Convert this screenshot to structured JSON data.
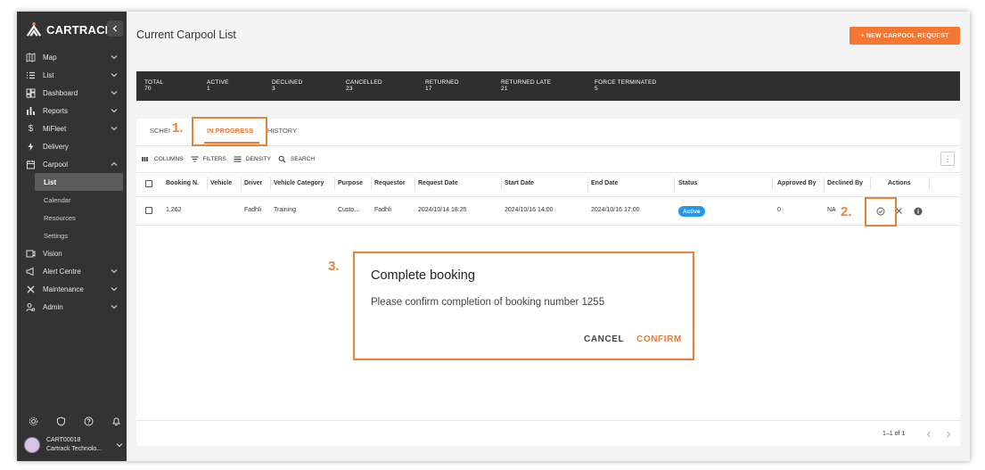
{
  "brand": {
    "name": "CARTRACK",
    "accent": "#f47735",
    "annotation_color": "#e9823a"
  },
  "sidebar": {
    "collapse_icon": "chevron-left-icon",
    "items": [
      {
        "label": "Map",
        "icon": "map-icon",
        "expandable": true
      },
      {
        "label": "List",
        "icon": "list-icon",
        "expandable": true
      },
      {
        "label": "Dashboard",
        "icon": "dashboard-icon",
        "expandable": true
      },
      {
        "label": "Reports",
        "icon": "bar-chart-icon",
        "expandable": true
      },
      {
        "label": "MiFleet",
        "icon": "dollar-icon",
        "expandable": true
      },
      {
        "label": "Delivery",
        "icon": "bolt-icon",
        "expandable": false
      },
      {
        "label": "Carpool",
        "icon": "calendar-icon",
        "expandable": true,
        "expanded": true
      },
      {
        "label": "List",
        "sub": true,
        "active": true
      },
      {
        "label": "Calendar",
        "sub": true
      },
      {
        "label": "Resources",
        "sub": true
      },
      {
        "label": "Settings",
        "sub": true
      },
      {
        "label": "Vision",
        "icon": "vision-icon",
        "expandable": false
      },
      {
        "label": "Alert Centre",
        "icon": "megaphone-icon",
        "expandable": true
      },
      {
        "label": "Maintenance",
        "icon": "tools-icon",
        "expandable": true
      },
      {
        "label": "Admin",
        "icon": "admin-icon",
        "expandable": true
      }
    ],
    "bottom_icons": [
      "settings-icon",
      "shield-icon",
      "help-icon",
      "bell-icon"
    ],
    "user": {
      "id": "CART00018",
      "company": "Cartrack Technolo..."
    }
  },
  "header": {
    "title": "Current Carpool List",
    "new_button": "+ NEW CARPOOL REQUEST"
  },
  "stats": [
    {
      "label": "TOTAL",
      "value": "70"
    },
    {
      "label": "ACTIVE",
      "value": "1"
    },
    {
      "label": "DECLINED",
      "value": "3"
    },
    {
      "label": "CANCELLED",
      "value": "23"
    },
    {
      "label": "RETURNED",
      "value": "17"
    },
    {
      "label": "RETURNED LATE",
      "value": "21"
    },
    {
      "label": "FORCE TERMINATED",
      "value": "5"
    }
  ],
  "tabs": {
    "scheduled": "SCHEI",
    "in_progress": "IN PROGRESS",
    "history": "HISTORY"
  },
  "toolbar": {
    "columns": "COLUMNS",
    "filters": "FILTERS",
    "density": "DENSITY",
    "search": "SEARCH"
  },
  "table": {
    "headers": {
      "booking": "Booking N.",
      "vehicle": "Vehicle",
      "driver": "Driver",
      "category": "Vehicle Category",
      "purpose": "Purpose",
      "requestor": "Requestor",
      "request_date": "Request Date",
      "start_date": "Start Date",
      "end_date": "End Date",
      "status": "Status",
      "approved_by": "Approved By",
      "declined_by": "Declined By",
      "actions": "Actions"
    },
    "row": {
      "booking": "1,262",
      "vehicle": "",
      "driver": "Fadhli",
      "category": "Training",
      "purpose": "Custo...",
      "requestor": "Fadhli",
      "request_date": "2024/10/14 18:25",
      "start_date": "2024/10/16 14:00",
      "end_date": "2024/10/16 17:00",
      "status": "Active",
      "approved_by": "0",
      "declined_by": "NA"
    }
  },
  "pagination": {
    "text": "1–1 of 1"
  },
  "annotations": {
    "one": "1.",
    "two": "2.",
    "three": "3."
  },
  "dialog": {
    "title": "Complete booking",
    "message": "Please confirm completion of booking number 1255",
    "cancel": "CANCEL",
    "confirm": "CONFIRM"
  }
}
